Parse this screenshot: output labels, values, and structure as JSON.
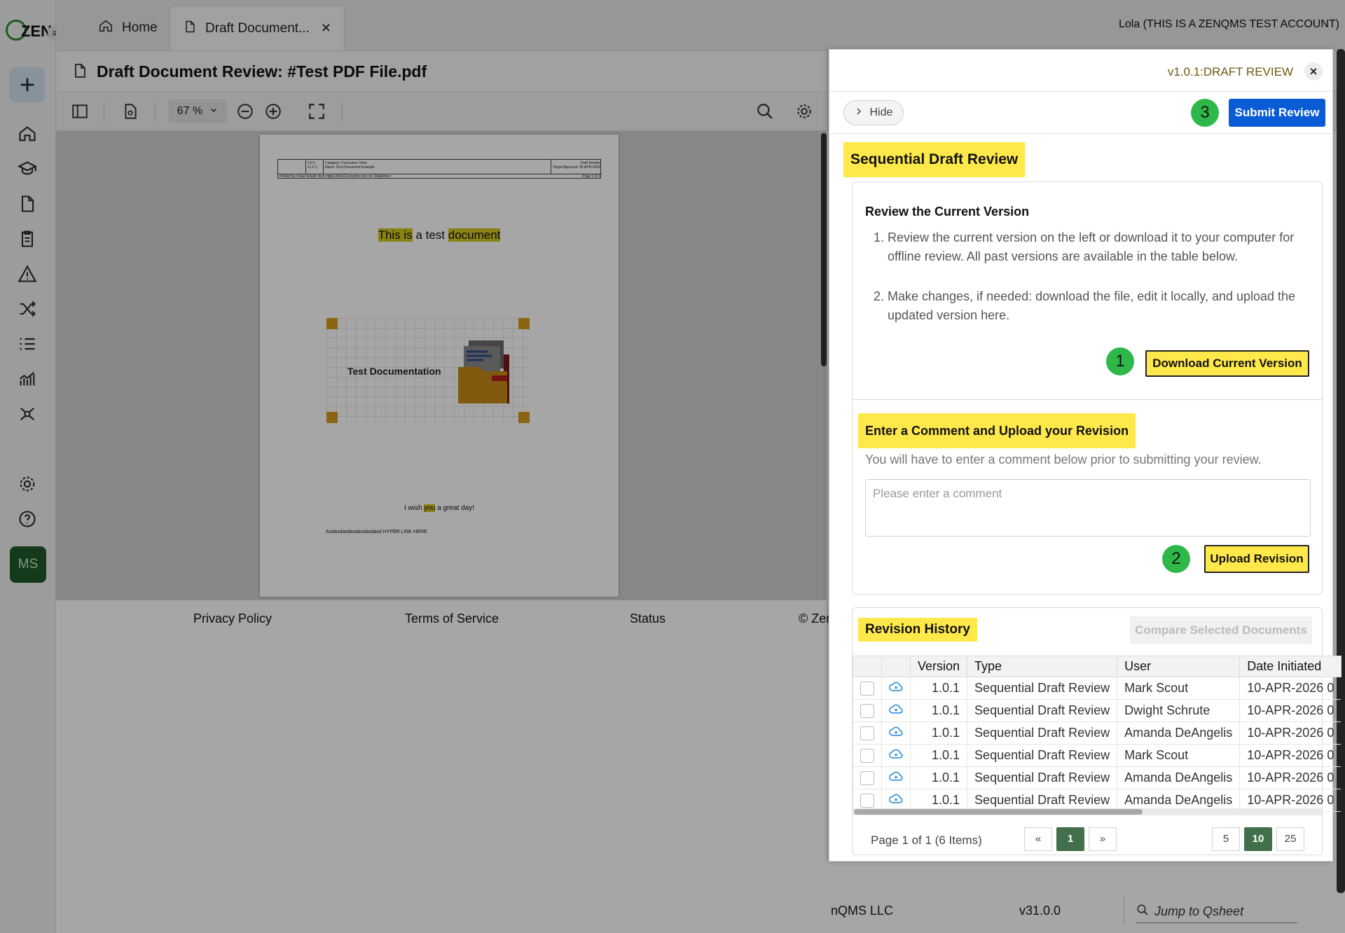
{
  "tabs": {
    "home_label": "Home",
    "doc_label": "Draft Document...",
    "user": "Lola (THIS IS A ZENQMS TEST ACCOUNT)"
  },
  "logo": {
    "text": "ZEN"
  },
  "sidebar": {
    "avatar_initials": "MS"
  },
  "document": {
    "title": "Draft Document Review: #Test PDF File.pdf",
    "zoom": "67 %"
  },
  "pdf_page": {
    "header_id": "CV-1",
    "header_ver": "v1.0.1",
    "header_category": "Category: Curriculum Vitae",
    "header_name": "Name: First Document Example",
    "header_status": "Draft Review",
    "header_target": "Target Approval: 09-APR-2026",
    "header_printed": "Printed by <User Email> from https://dev10.zenqms.com on <Datetime>",
    "header_page": "Page 1 of 1",
    "line1_part1": "This is",
    "line1_part2": " a test ",
    "line1_part3": "document",
    "illustration_label": "Test Documentation",
    "line2_part1": "I wish ",
    "line2_part2": "you",
    "line2_part3": " a great day!",
    "line3": "Asdasdasdasdasdasdasd HYPER LINK HERE"
  },
  "footer": {
    "privacy": "Privacy Policy",
    "terms": "Terms of Service",
    "status": "Status",
    "copyright": "© Zer",
    "company": "nQMS LLC",
    "version": "v31.0.0",
    "jump_placeholder": "Jump to Qsheet"
  },
  "panel": {
    "version_label": "v1.0.1:DRAFT REVIEW",
    "hide_label": "Hide",
    "submit_label": "Submit Review",
    "badge1": "1",
    "badge2": "2",
    "badge3": "3",
    "heading": "Sequential Draft Review",
    "review_title": "Review the Current Version",
    "step1": "Review the current version on the left or download it to your computer for offline review. All past versions are available in the table below.",
    "step2": "Make changes, if needed: download the file, edit it locally, and upload the updated version here.",
    "download_label": "Download Current Version",
    "comment_title": "Enter a Comment and Upload your Revision",
    "comment_hint": "You will have to enter a comment below prior to submitting your review.",
    "comment_placeholder": "Please enter a comment",
    "upload_label": "Upload Revision",
    "history_title": "Revision History",
    "compare_label": "Compare Selected Documents",
    "columns": [
      "Version",
      "Type",
      "User",
      "Date Initiated"
    ],
    "rows": [
      {
        "version": "1.0.1",
        "type": "Sequential Draft Review",
        "user": "Mark Scout",
        "date": "10-APR-2026 0"
      },
      {
        "version": "1.0.1",
        "type": "Sequential Draft Review",
        "user": "Dwight Schrute",
        "date": "10-APR-2026 0"
      },
      {
        "version": "1.0.1",
        "type": "Sequential Draft Review",
        "user": "Amanda DeAngelis",
        "date": "10-APR-2026 0"
      },
      {
        "version": "1.0.1",
        "type": "Sequential Draft Review",
        "user": "Mark Scout",
        "date": "10-APR-2026 0"
      },
      {
        "version": "1.0.1",
        "type": "Sequential Draft Review",
        "user": "Amanda DeAngelis",
        "date": "10-APR-2026 0"
      },
      {
        "version": "1.0.1",
        "type": "Sequential Draft Review",
        "user": "Amanda DeAngelis",
        "date": "10-APR-2026 0"
      }
    ],
    "pager_text": "Page 1 of 1 (6 Items)",
    "pager_prev": "«",
    "pager_current": "1",
    "pager_next": "»",
    "page_sizes": [
      "5",
      "10",
      "25"
    ],
    "page_size_selected": "10"
  },
  "colors": {
    "highlight": "#ffe94a",
    "submit": "#0a5cd6",
    "badge": "#2eb84a",
    "pager_active": "#41704a"
  }
}
